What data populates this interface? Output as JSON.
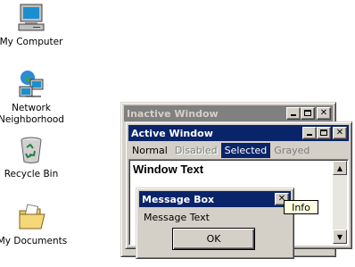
{
  "desktop": {
    "icons": [
      {
        "label": "My Computer",
        "icon": "computer-icon"
      },
      {
        "label": "Network",
        "label2": "Neighborhood",
        "icon": "network-icon"
      },
      {
        "label": "Recycle Bin",
        "icon": "recycle-bin-icon"
      },
      {
        "label": "My Documents",
        "icon": "folder-icon"
      }
    ]
  },
  "inactive_window": {
    "title": "Inactive Window"
  },
  "active_window": {
    "title": "Active Window",
    "menu": {
      "normal": "Normal",
      "disabled": "Disabled",
      "selected": "Selected",
      "grayed": "Grayed"
    },
    "client_text": "Window Text"
  },
  "message_box": {
    "title": "Message Box",
    "text": "Message Text",
    "ok_label": "OK"
  },
  "tooltip": {
    "text": "Info"
  },
  "colors": {
    "active_title": "#0a246a",
    "inactive_title": "#808080",
    "face": "#d4d0c8",
    "tooltip_bg": "#ffffe1"
  }
}
